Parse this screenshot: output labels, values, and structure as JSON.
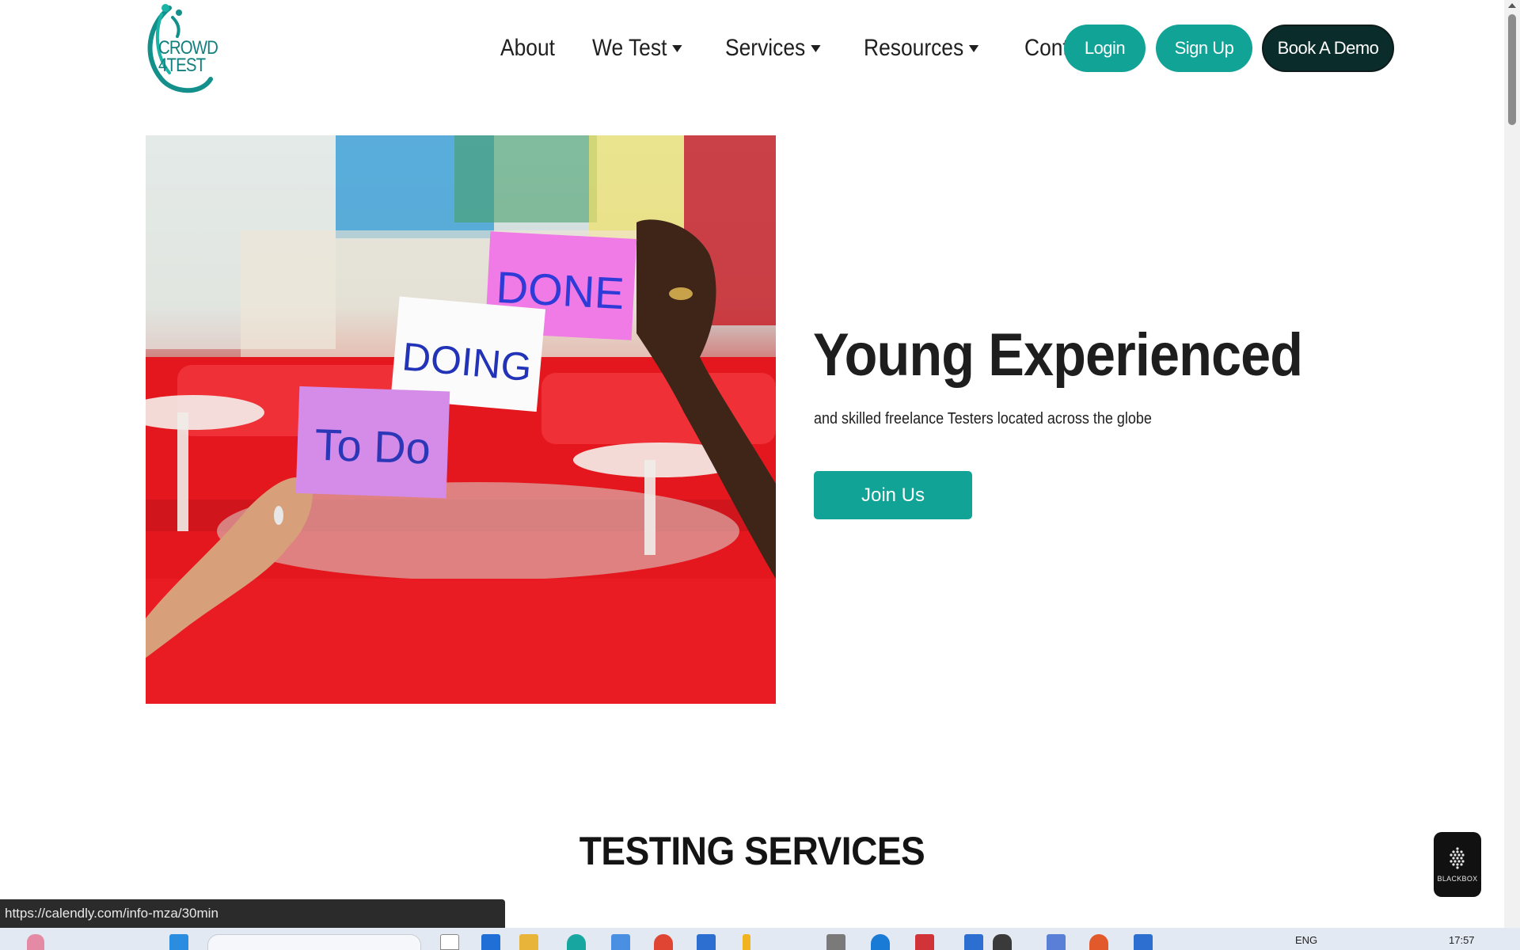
{
  "site": {
    "logo_text_line1": "CROWD",
    "logo_text_line2": "4TEST"
  },
  "nav": {
    "items": [
      {
        "label": "About",
        "has_caret": false
      },
      {
        "label": "We Test",
        "has_caret": true
      },
      {
        "label": "Services",
        "has_caret": true
      },
      {
        "label": "Resources",
        "has_caret": true
      },
      {
        "label": "Contact",
        "has_caret": false
      }
    ],
    "login_label": "Login",
    "signup_label": "Sign Up",
    "demo_label": "Book A Demo"
  },
  "hero": {
    "title": "Young Experienced",
    "subtitle": "and skilled freelance Testers located across the globe",
    "join_label": "Join Us",
    "cards": {
      "done": "DONE",
      "doing": "DOING",
      "todo": "To Do"
    }
  },
  "sections": {
    "testing_title": "TESTING SERVICES"
  },
  "status_bar": {
    "url": "https://calendly.com/info-mza/30min"
  },
  "widget": {
    "label": "BLACKBOX"
  },
  "taskbar": {
    "lang": "ENG",
    "time": "17:57"
  },
  "colors": {
    "accent": "#11a396",
    "dark_button": "#0a2c2a",
    "text": "#1e1e1e"
  }
}
